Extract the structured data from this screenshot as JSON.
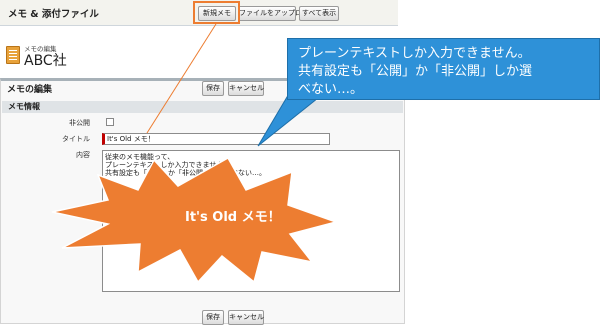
{
  "related_list": {
    "title": "メモ & 添付ファイル",
    "buttons": {
      "new_note": "新規メモ",
      "upload_file": "ファイルをアップロード",
      "show_all": "すべて表示"
    }
  },
  "edit_page": {
    "subtitle": "メモの編集",
    "record_name": "ABC社",
    "form_title": "メモの編集",
    "save_label": "保存",
    "cancel_label": "キャンセル",
    "section_title": "メモ情報",
    "fields": {
      "private_label": "非公開",
      "title_label": "タイトル",
      "title_value": "It's Old メモ！",
      "content_label": "内容",
      "content_lines": [
        "従来のメモ機能って、",
        "プレーンテキストしか入力できません。",
        "共有設定も「公開」か「非公開」しか選べない…。"
      ]
    }
  },
  "annotations": {
    "callout_lines": [
      "プレーンテキストしか入力できません。",
      "共有設定も「公開」か「非公開」しか選",
      "べない…。"
    ],
    "burst_text": "It's Old メモ！",
    "highlight_color": "#ed7d31",
    "callout_color": "#2e91d8"
  }
}
